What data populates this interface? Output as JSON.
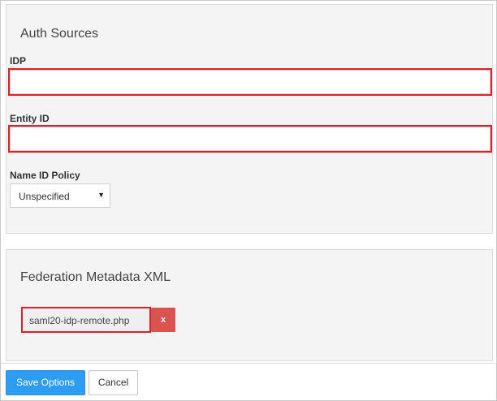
{
  "auth_sources": {
    "title": "Auth Sources",
    "idp": {
      "label": "IDP",
      "value": ""
    },
    "entity_id": {
      "label": "Entity ID",
      "value": ""
    },
    "name_id_policy": {
      "label": "Name ID Policy",
      "selected": "Unspecified",
      "arrow": "▼"
    }
  },
  "federation": {
    "title": "Federation Metadata XML",
    "file_name": "saml20-idp-remote.php",
    "remove_label": "x"
  },
  "footer": {
    "save_label": "Save Options",
    "cancel_label": "Cancel"
  },
  "colors": {
    "highlight": "#e0202a",
    "primary": "#2d9cf4",
    "danger": "#d9534f"
  }
}
